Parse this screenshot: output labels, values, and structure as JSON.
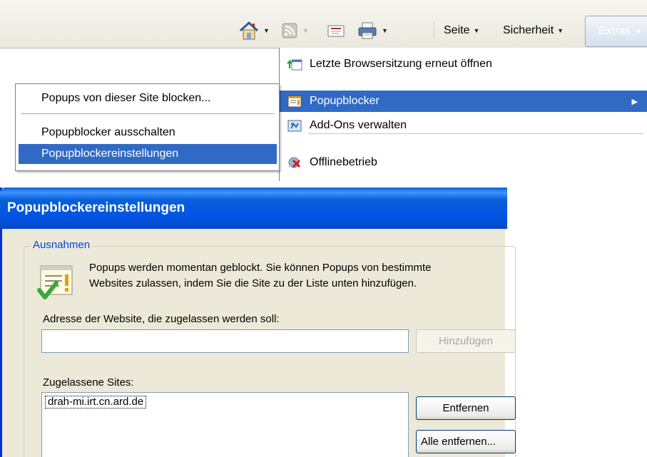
{
  "toolbar": {
    "items": [
      {
        "icon": "home-icon",
        "has_dropdown": true
      },
      {
        "icon": "feeds-icon",
        "has_dropdown": true,
        "disabled": true
      },
      {
        "icon": "read-mail-icon",
        "has_dropdown": false
      },
      {
        "icon": "print-icon",
        "has_dropdown": true
      }
    ],
    "page_label": "Seite",
    "security_label": "Sicherheit",
    "tools_label": "Extras"
  },
  "tools_menu": {
    "items": [
      {
        "label": "Letzte Browsersitzung erneut öffnen",
        "icon": "reopen-session-icon"
      },
      {
        "label": "Popupblocker",
        "icon": "popup-blocker-icon",
        "selected": true,
        "has_submenu": true
      },
      {
        "label": "Add-Ons verwalten",
        "icon": "manage-addons-icon"
      },
      {
        "label": "Offlinebetrieb",
        "icon": "work-offline-icon"
      }
    ]
  },
  "popup_submenu": {
    "items": [
      {
        "label": "Popups von dieser Site blocken..."
      },
      {
        "label": "Popupblocker ausschalten"
      },
      {
        "label": "Popupblockereinstellungen",
        "selected": true
      }
    ]
  },
  "dialog": {
    "title": "Popupblockereinstellungen",
    "group_label": "Ausnahmen",
    "info_line1": "Popups werden momentan geblockt. Sie können Popups von bestimmte",
    "info_line2": "Websites zulassen, indem Sie die Site zu der Liste unten hinzufügen.",
    "address_label": "Adresse der Website, die zugelassen werden soll:",
    "address_value": "",
    "add_button": "Hinzufügen",
    "allowed_label": "Zugelassene Sites:",
    "allowed_sites": [
      "drah-mi.irt.cn.ard.de"
    ],
    "remove_button": "Entfernen",
    "remove_all_button": "Alle entfernen..."
  }
}
